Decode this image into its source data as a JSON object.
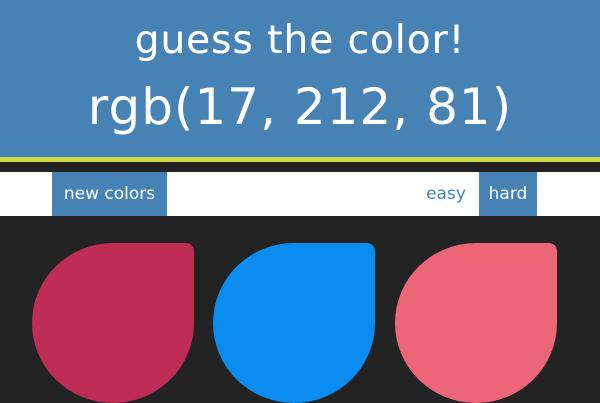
{
  "header": {
    "title": "guess the color!",
    "rgb_display": "rgb(17, 212, 81)"
  },
  "controls": {
    "new_colors_label": "new colors",
    "easy_label": "easy",
    "hard_label": "hard",
    "selected_mode": "hard"
  },
  "squares": [
    {
      "color": "#bf2d55"
    },
    {
      "color": "#0a8cf0"
    },
    {
      "color": "#ed6677"
    }
  ],
  "colors": {
    "header_bg": "#4682b4",
    "accent_stripe": "#c9d94a",
    "board_bg": "#232323",
    "controls_bg": "#ffffff"
  }
}
